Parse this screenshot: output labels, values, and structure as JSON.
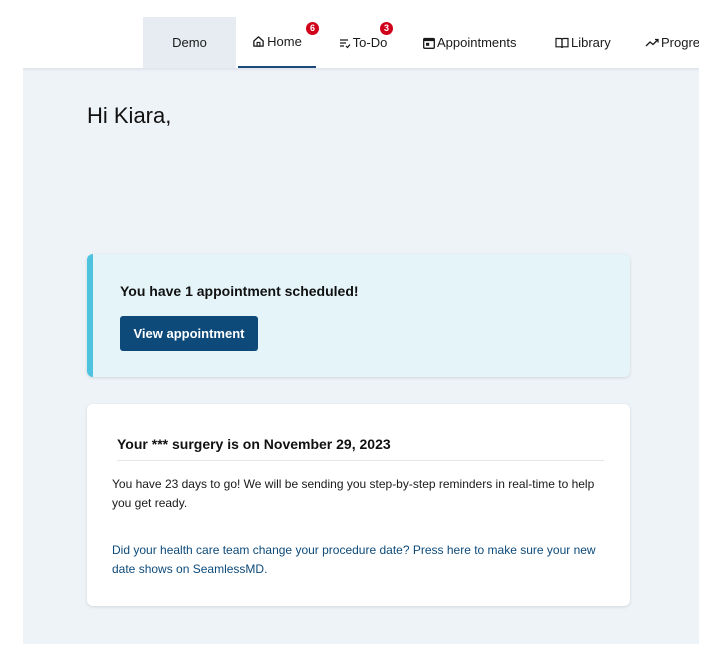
{
  "nav": {
    "demo_label": "Demo",
    "items": [
      {
        "label": "Home",
        "icon": "home-icon",
        "badge": "6",
        "active": true
      },
      {
        "label": "To-Do",
        "icon": "checklist-icon",
        "badge": "3"
      },
      {
        "label": "Appointments",
        "icon": "calendar-icon"
      },
      {
        "label": "Library",
        "icon": "book-icon"
      },
      {
        "label": "Progre",
        "icon": "trend-icon"
      }
    ]
  },
  "greeting": "Hi Kiara,",
  "appointment_card": {
    "title": "You have 1 appointment scheduled!",
    "button_label": "View appointment",
    "accent_color": "#4ec3e0",
    "button_color": "#0d4a7a"
  },
  "surgery_card": {
    "heading": "Your *** surgery is on November 29, 2023",
    "body": "You have 23 days to go! We will be sending you step-by-step reminders in real-time to help you get ready.",
    "link_text": "Did your health care team change your procedure date? Press here to make sure your new date shows on SeamlessMD."
  },
  "colors": {
    "badge": "#d0021b",
    "link": "#0d4a7a",
    "background": "#eef3f8"
  }
}
